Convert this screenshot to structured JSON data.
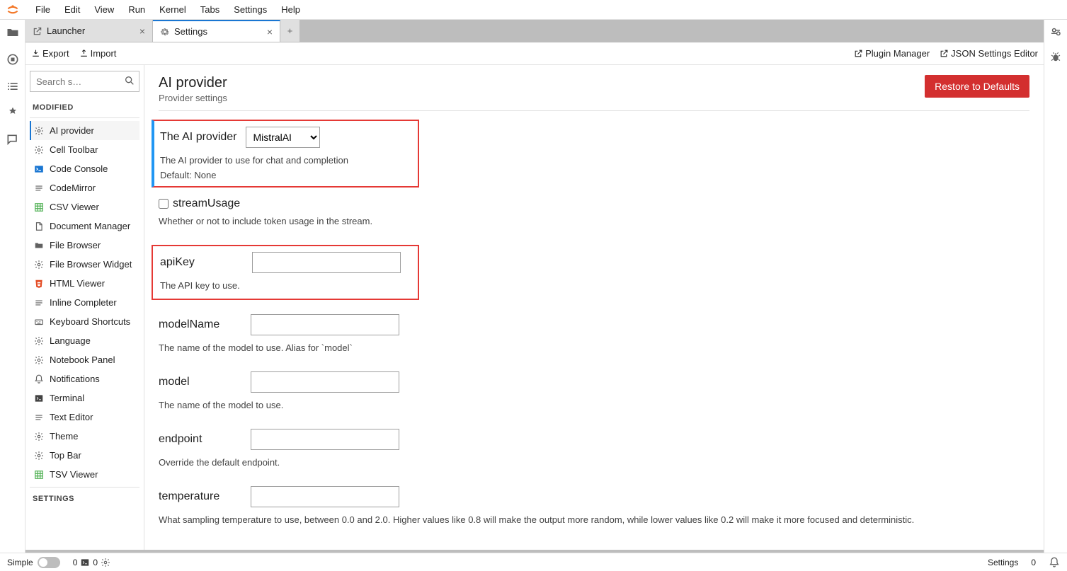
{
  "menubar": [
    "File",
    "Edit",
    "View",
    "Run",
    "Kernel",
    "Tabs",
    "Settings",
    "Help"
  ],
  "tabs": [
    {
      "label": "Launcher",
      "icon": "launch"
    },
    {
      "label": "Settings",
      "icon": "gear"
    }
  ],
  "toolbar": {
    "export": "Export",
    "import": "Import",
    "plugin_manager": "Plugin Manager",
    "json_editor": "JSON Settings Editor"
  },
  "search_placeholder": "Search s…",
  "section_modified": "MODIFIED",
  "section_settings": "SETTINGS",
  "categories": [
    {
      "label": "AI provider",
      "icon": "gear"
    },
    {
      "label": "Cell Toolbar",
      "icon": "gear"
    },
    {
      "label": "Code Console",
      "icon": "console"
    },
    {
      "label": "CodeMirror",
      "icon": "lines"
    },
    {
      "label": "CSV Viewer",
      "icon": "grid"
    },
    {
      "label": "Document Manager",
      "icon": "doc"
    },
    {
      "label": "File Browser",
      "icon": "folder"
    },
    {
      "label": "File Browser Widget",
      "icon": "gear"
    },
    {
      "label": "HTML Viewer",
      "icon": "html"
    },
    {
      "label": "Inline Completer",
      "icon": "lines"
    },
    {
      "label": "Keyboard Shortcuts",
      "icon": "keyboard"
    },
    {
      "label": "Language",
      "icon": "gear"
    },
    {
      "label": "Notebook Panel",
      "icon": "gear"
    },
    {
      "label": "Notifications",
      "icon": "bell"
    },
    {
      "label": "Terminal",
      "icon": "terminal"
    },
    {
      "label": "Text Editor",
      "icon": "lines"
    },
    {
      "label": "Theme",
      "icon": "gear"
    },
    {
      "label": "Top Bar",
      "icon": "gear"
    },
    {
      "label": "TSV Viewer",
      "icon": "grid"
    }
  ],
  "content": {
    "title": "AI provider",
    "subtitle": "Provider settings",
    "restore": "Restore to Defaults",
    "fields": {
      "provider": {
        "label": "The AI provider",
        "value": "MistralAI",
        "desc": "The AI provider to use for chat and completion",
        "default": "Default: None"
      },
      "streamUsage": {
        "label": "streamUsage",
        "desc": "Whether or not to include token usage in the stream."
      },
      "apiKey": {
        "label": "apiKey",
        "desc": "The API key to use."
      },
      "modelName": {
        "label": "modelName",
        "desc": "The name of the model to use. Alias for `model`"
      },
      "model": {
        "label": "model",
        "desc": "The name of the model to use."
      },
      "endpoint": {
        "label": "endpoint",
        "desc": "Override the default endpoint."
      },
      "temperature": {
        "label": "temperature",
        "desc": "What sampling temperature to use, between 0.0 and 2.0. Higher values like 0.8 will make the output more random, while lower values like 0.2 will make it more focused and deterministic."
      }
    }
  },
  "statusbar": {
    "simple": "Simple",
    "kernel1": "0",
    "kernel2": "0",
    "right_label": "Settings",
    "right_count": "0"
  }
}
